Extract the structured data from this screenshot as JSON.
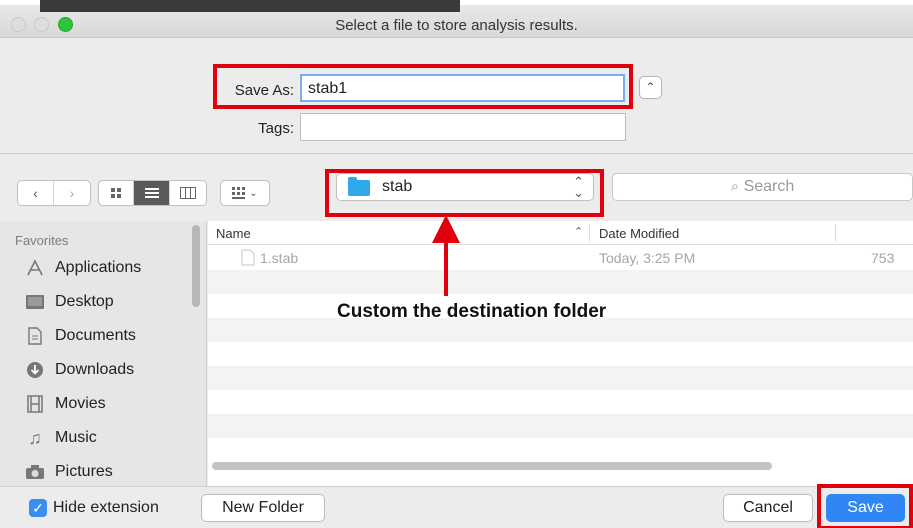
{
  "window": {
    "title": "Select a file to store analysis results."
  },
  "form": {
    "save_as_label": "Save As:",
    "save_as_value": "stab1",
    "tags_label": "Tags:",
    "tags_value": ""
  },
  "toolbar": {
    "location": "stab",
    "search_placeholder": "Search"
  },
  "sidebar": {
    "heading": "Favorites",
    "items": [
      {
        "label": "Applications",
        "icon": "applications-icon"
      },
      {
        "label": "Desktop",
        "icon": "desktop-icon"
      },
      {
        "label": "Documents",
        "icon": "documents-icon"
      },
      {
        "label": "Downloads",
        "icon": "downloads-icon"
      },
      {
        "label": "Movies",
        "icon": "movies-icon"
      },
      {
        "label": "Music",
        "icon": "music-icon"
      },
      {
        "label": "Pictures",
        "icon": "pictures-icon"
      }
    ]
  },
  "file_list": {
    "columns": [
      "Name",
      "Date Modified"
    ],
    "rows": [
      {
        "name": "1.stab",
        "date": "Today, 3:25 PM",
        "size": "753"
      }
    ]
  },
  "annotation": {
    "text": "Custom the destination folder",
    "color": "#e0000d"
  },
  "footer": {
    "hide_extension_label": "Hide extension",
    "hide_extension_checked": true,
    "new_folder_label": "New Folder",
    "cancel_label": "Cancel",
    "save_label": "Save"
  },
  "colors": {
    "accent": "#2f86f4",
    "highlight_red": "#e0000d",
    "folder_blue": "#2fa8ea"
  }
}
